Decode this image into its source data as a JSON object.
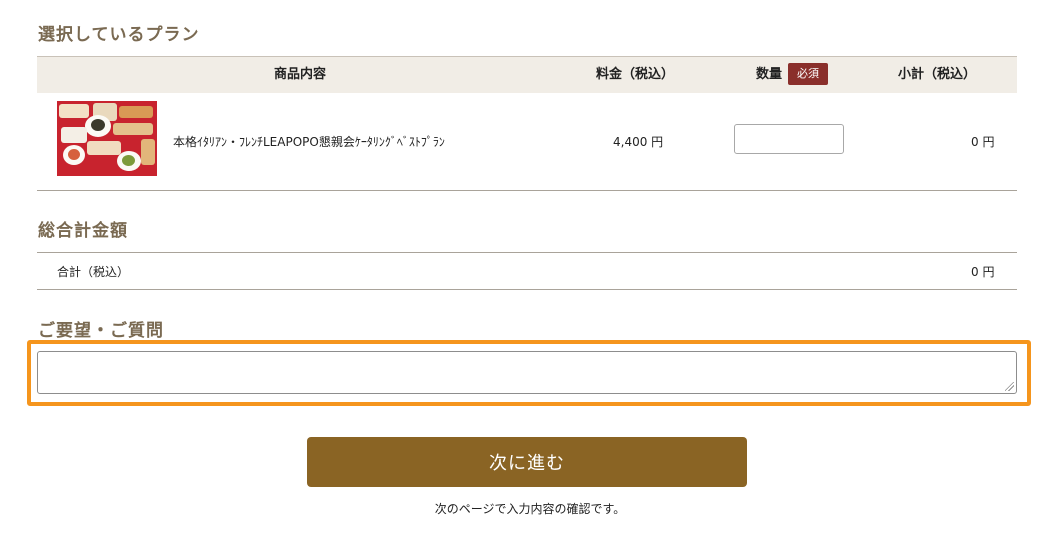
{
  "plan_section": {
    "title": "選択しているプラン",
    "headers": {
      "product": "商品内容",
      "price": "料金（税込）",
      "quantity": "数量",
      "required_badge": "必須",
      "subtotal": "小計（税込）"
    },
    "item": {
      "name": "本格ｲﾀﾘｱﾝ・ﾌﾚﾝﾁLEAPOPO懇親会ｹｰﾀﾘﾝｸﾞﾍﾞｽﾄﾌﾟﾗﾝ",
      "price": "4,400 円",
      "quantity": "",
      "subtotal": "0 円"
    }
  },
  "total_section": {
    "title": "総合計金額",
    "label": "合計（税込）",
    "value": "0 円"
  },
  "request_section": {
    "title": "ご要望・ご質問",
    "value": ""
  },
  "next_button": "次に進む",
  "note": "次のページで入力内容の確認です。",
  "colors": {
    "accent": "#f5951d",
    "button": "#8a6424",
    "badge": "#8a2f2b",
    "header_bg": "#f1ede6"
  }
}
